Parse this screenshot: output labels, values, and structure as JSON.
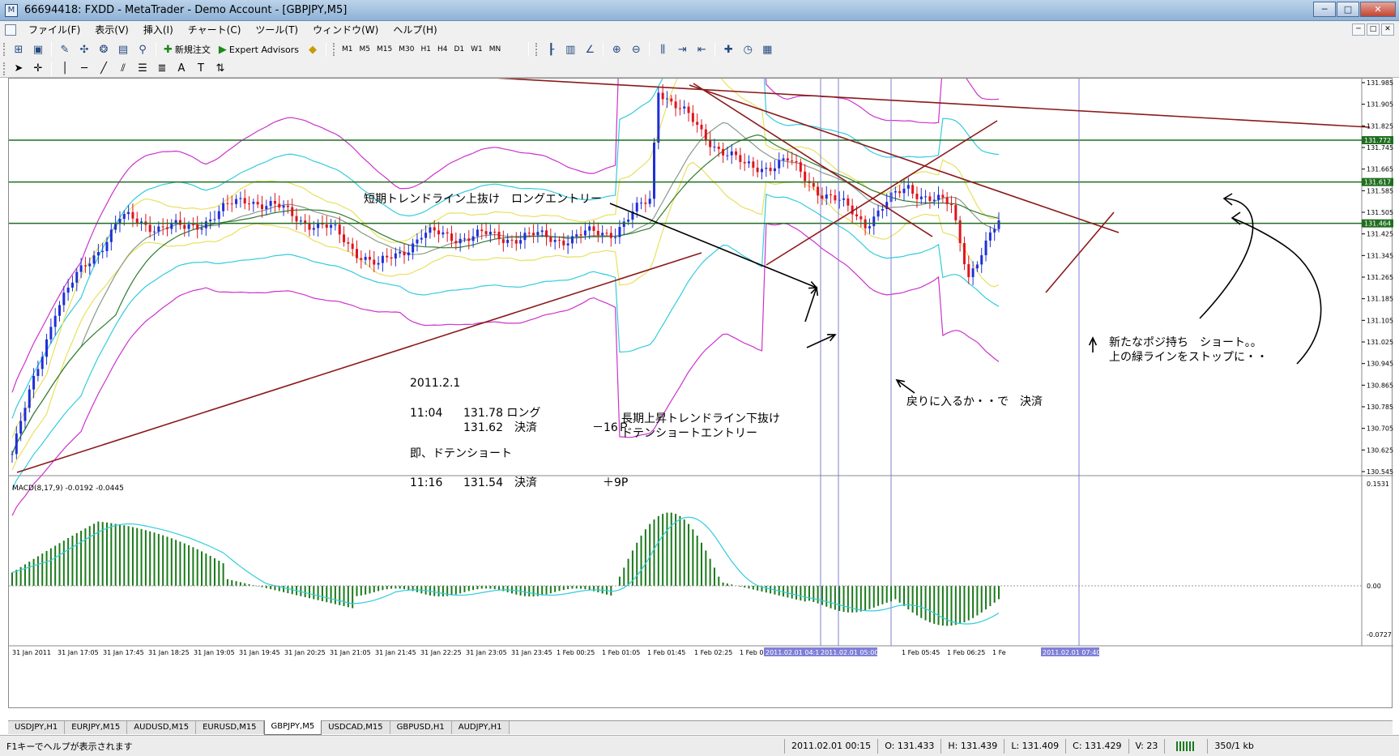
{
  "window": {
    "title": "66694418: FXDD - MetaTrader - Demo Account - [GBPJPY,M5]",
    "close_glyph": "✕",
    "minimize_glyph": "─",
    "maximize_glyph": "□"
  },
  "menu": {
    "items": [
      "ファイル(F)",
      "表示(V)",
      "挿入(I)",
      "チャート(C)",
      "ツール(T)",
      "ウィンドウ(W)",
      "ヘルプ(H)"
    ]
  },
  "toolbar": {
    "new_order": "新規注文",
    "expert_advisors": "Expert Advisors",
    "timeframes": [
      "M1",
      "M5",
      "M15",
      "M30",
      "H1",
      "H4",
      "D1",
      "W1",
      "MN"
    ]
  },
  "chart": {
    "symbol": "GBPJPY,M5",
    "price_levels": [
      "131.985",
      "131.905",
      "131.825",
      "131.745",
      "131.665",
      "131.585",
      "131.505",
      "131.425",
      "131.345",
      "131.265",
      "131.185",
      "131.105",
      "131.025",
      "130.945",
      "130.865",
      "130.785",
      "130.705",
      "130.625",
      "130.545"
    ],
    "price_range": [
      130.53,
      132.0
    ],
    "hlines": [
      {
        "price": 131.772,
        "label": "131.772"
      },
      {
        "price": 131.617,
        "label": "131.617"
      },
      {
        "price": 131.464,
        "label": "131.464"
      }
    ],
    "time_labels": [
      "31 Jan 2011",
      "31 Jan 17:05",
      "31 Jan 17:45",
      "31 Jan 18:25",
      "31 Jan 19:05",
      "31 Jan 19:45",
      "31 Jan 20:25",
      "31 Jan 21:05",
      "31 Jan 21:45",
      "31 Jan 22:25",
      "31 Jan 23:05",
      "31 Jan 23:45",
      "1 Feb 00:25",
      "1 Feb 01:05",
      "1 Feb 01:45",
      "1 Feb 02:25",
      "1 Feb 03:05",
      "1 Feb 05:45",
      "1 Feb 06:25",
      "1 Fe"
    ],
    "time_highlights": [
      "2011.02.01 04:1",
      "2011.02.01 05:00",
      "2011.02.01 07:40"
    ],
    "macd_label": "MACD(8,17,9) -0.0192 -0.0445",
    "macd_levels": [
      "0.1531",
      "0.00",
      "-0.0727"
    ],
    "annotations": {
      "short_breakout": "短期トレンドライン上抜け　ロングエントリー",
      "long_break_line1": "長期上昇トレンドライン下抜け",
      "long_break_line2": "ドテンショートエントリー",
      "date": "2011.2.1",
      "trade1_time": "11:04",
      "trade1_price": "131.78 ロング",
      "trade1_close_price": "131.62　決済",
      "trade1_pips": "－16Ｐ",
      "doten": "即、ドテンショート",
      "trade2_time": "11:16",
      "trade2_price": "131.54　決済",
      "trade2_pips": "＋9P",
      "pullback": "戻りに入るか・・で　決済",
      "new_pos_line1": "新たなポジ持ち　ショート。。",
      "new_pos_line2": "上の緑ラインをストップに・・"
    }
  },
  "tabs": [
    "USDJPY,H1",
    "EURJPY,M15",
    "AUDUSD,M15",
    "EURUSD,M15",
    "GBPJPY,M5",
    "USDCAD,M15",
    "GBPUSD,H1",
    "AUDJPY,H1"
  ],
  "active_tab": "GBPJPY,M5",
  "status": {
    "help": "F1キーでヘルプが表示されます",
    "datetime": "2011.02.01 00:15",
    "open": "O: 131.433",
    "high": "H: 131.439",
    "low": "L: 131.409",
    "close": "C: 131.429",
    "volume": "V: 23",
    "traffic": "350/1 kb"
  },
  "colors": {
    "bull": "#1f2fd6",
    "bear": "#e0141c",
    "trendline": "#8b1a1a",
    "hline": "#1f6e1f",
    "bb_outer": "#cc33cc",
    "bb_mid": "#33ccdd",
    "bb_inner": "#e8e060",
    "ma": "#8a9a8a",
    "macd_hist": "#1a7a1a",
    "macd_signal": "#33ccdd",
    "vline": "#7f7fd0"
  }
}
